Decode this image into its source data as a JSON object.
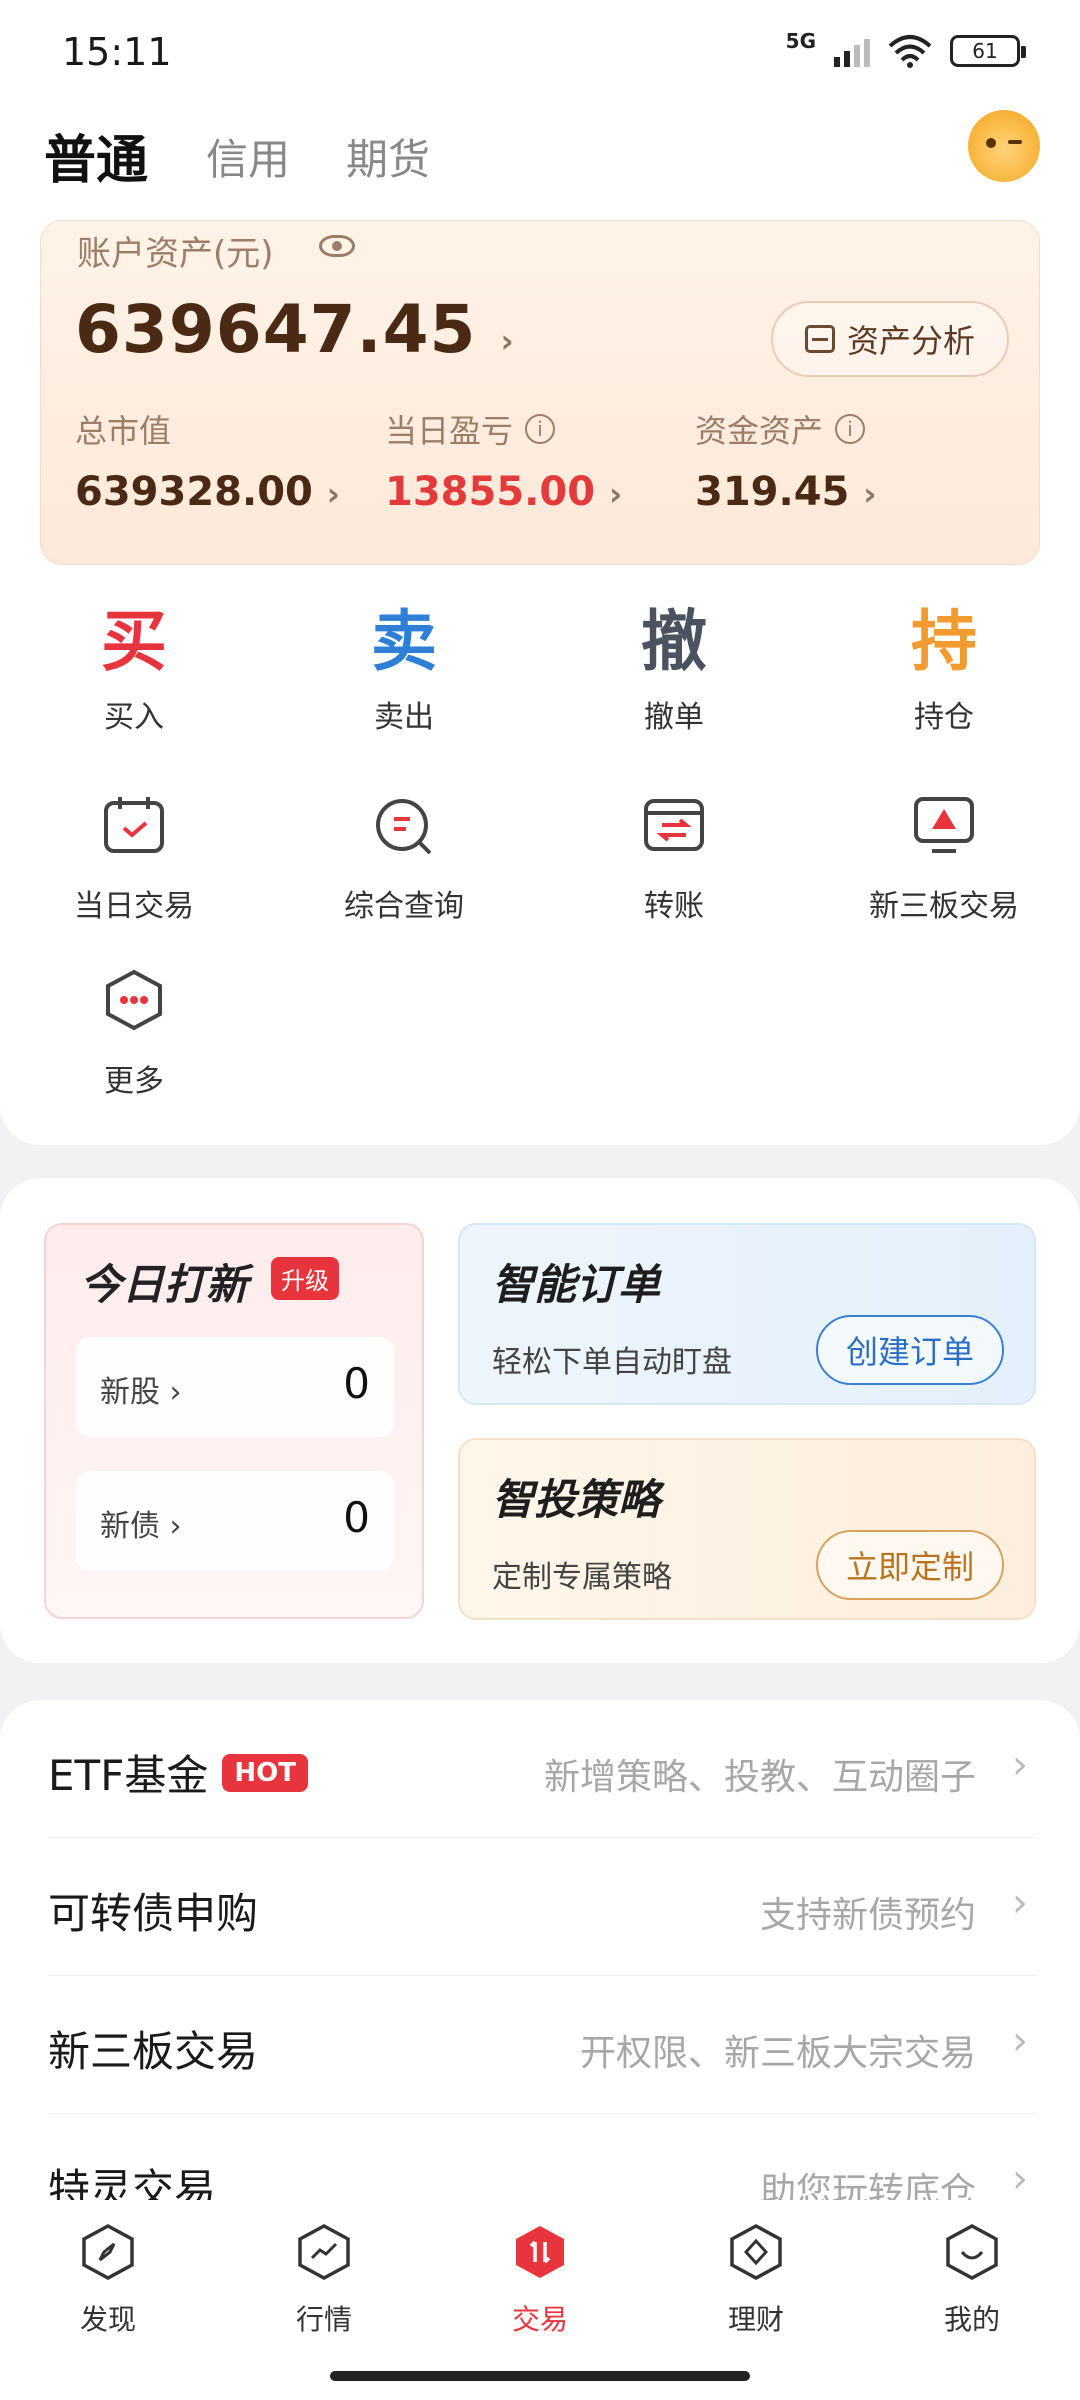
{
  "status_bar": {
    "time": "15:11",
    "network": "5G",
    "battery": "61"
  },
  "header": {
    "tabs": [
      {
        "label": "普通"
      },
      {
        "label": "信用"
      },
      {
        "label": "期货"
      }
    ]
  },
  "asset": {
    "title": "账户资产(元)",
    "total": "639647.45",
    "analysis_label": "资产分析",
    "stats": [
      {
        "label": "总市值",
        "value": "639328.00"
      },
      {
        "label": "当日盈亏",
        "value": "13855.00"
      },
      {
        "label": "资金资产",
        "value": "319.45"
      }
    ]
  },
  "actions": [
    {
      "char": "买",
      "label": "买入",
      "color": "#e8343c"
    },
    {
      "char": "卖",
      "label": "卖出",
      "color": "#2f7fd6"
    },
    {
      "char": "撤",
      "label": "撤单",
      "color": "#4b5260"
    },
    {
      "char": "持",
      "label": "持仓",
      "color": "#f29b30"
    }
  ],
  "tools": [
    {
      "label": "当日交易",
      "icon": "calendar-check-icon"
    },
    {
      "label": "综合查询",
      "icon": "search-query-icon"
    },
    {
      "label": "转账",
      "icon": "transfer-icon"
    },
    {
      "label": "新三板交易",
      "icon": "monitor-icon"
    },
    {
      "label": "更多",
      "icon": "more-icon"
    }
  ],
  "ipo": {
    "title": "今日打新",
    "badge": "升级",
    "rows": [
      {
        "label": "新股",
        "value": "0"
      },
      {
        "label": "新债",
        "value": "0"
      }
    ]
  },
  "smart_order": {
    "title": "智能订单",
    "sub": "轻松下单自动盯盘",
    "button": "创建订单"
  },
  "strategy": {
    "title": "智投策略",
    "sub": "定制专属策略",
    "button": "立即定制"
  },
  "list": [
    {
      "title": "ETF基金",
      "badge": "HOT",
      "desc": "新增策略、投教、互动圈子"
    },
    {
      "title": "可转债申购",
      "badge": "",
      "desc": "支持新债预约"
    },
    {
      "title": "新三板交易",
      "badge": "",
      "desc": "开权限、新三板大宗交易"
    },
    {
      "title": "特灵交易",
      "badge": "",
      "desc": "助您玩转底仓"
    }
  ],
  "nav": [
    {
      "label": "发现",
      "icon": "compass-icon"
    },
    {
      "label": "行情",
      "icon": "trend-icon"
    },
    {
      "label": "交易",
      "icon": "trade-icon"
    },
    {
      "label": "理财",
      "icon": "wealth-icon"
    },
    {
      "label": "我的",
      "icon": "profile-icon"
    }
  ],
  "colors": {
    "accent": "#e8343c",
    "profit": "#e33b3b",
    "brown": "#4a2a14"
  }
}
